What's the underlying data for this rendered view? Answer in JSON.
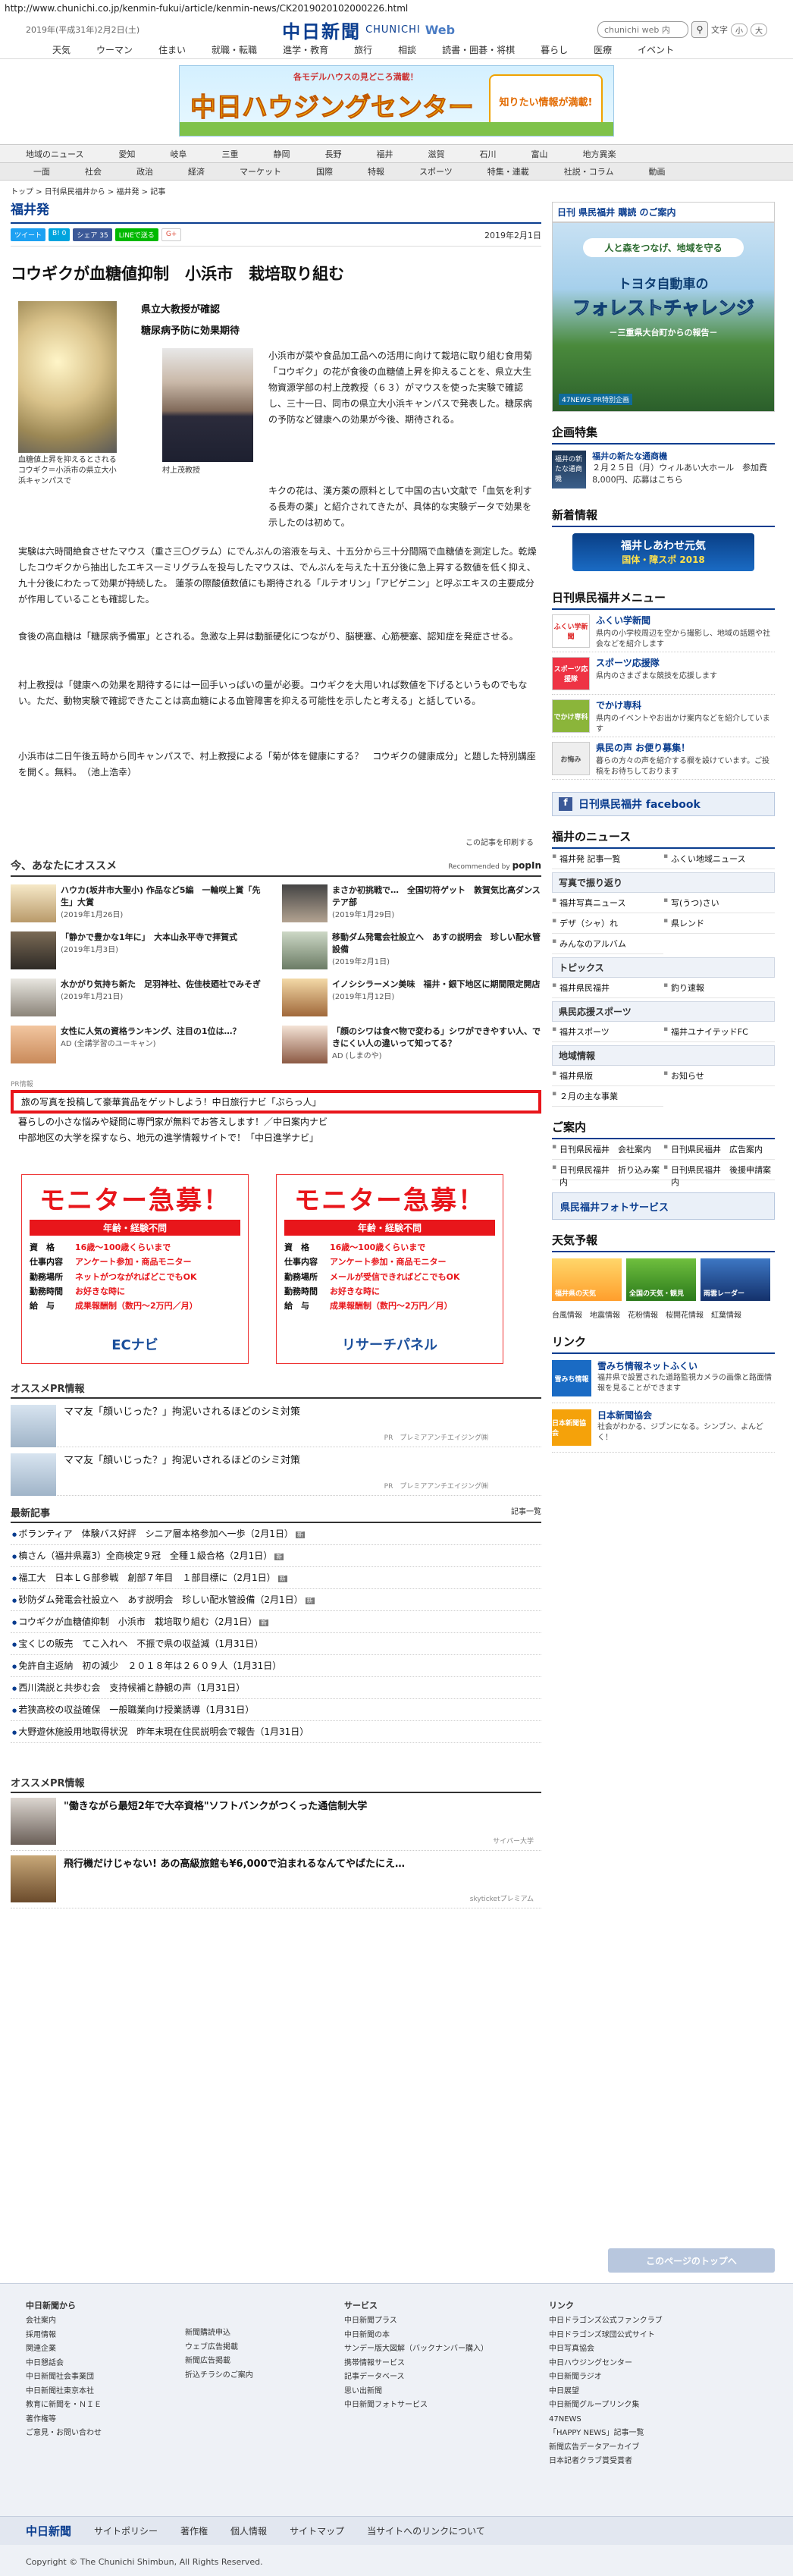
{
  "browser": {
    "url": "http://www.chunichi.co.jp/kenmin-fukui/article/kenmin-news/CK2019020102000226.html"
  },
  "header": {
    "date": "2019年(平成31年)2月2日(土)",
    "logo_jp": "中日新聞",
    "logo_en": "CHUNICHI",
    "logo_web": "Web",
    "search_placeholder": "chunichi web 内",
    "font_size_label": "文字",
    "font_small": "小",
    "font_large": "大"
  },
  "global_nav": [
    "天気",
    "ウーマン",
    "住まい",
    "就職・転職",
    "進学・教育",
    "旅行",
    "相談",
    "読書・囲碁・将棋",
    "暮らし",
    "医療",
    "イベント"
  ],
  "top_banner": {
    "sub": "各モデルハウスの見どころ満載！",
    "main": "中日ハウジングセンター",
    "right": "知りたい情報が満載!"
  },
  "region_nav": [
    "地域のニュース",
    "愛知",
    "岐阜",
    "三重",
    "静岡",
    "長野",
    "福井",
    "滋賀",
    "石川",
    "富山",
    "地方異楽"
  ],
  "category_nav": [
    "一面",
    "社会",
    "政治",
    "経済",
    "マーケット",
    "国際",
    "特報",
    "スポーツ",
    "特集・連載",
    "社説・コラム",
    "動画"
  ],
  "breadcrumb": "トップ > 日刊県民福井から > 福井発 > 記事",
  "section_title": "福井発",
  "share": {
    "tweet": "ツイート",
    "hatena": "B! 0",
    "fb_share": "シェア 35",
    "line": "LINEで送る",
    "gplus": "G+",
    "pub_date": "2019年2月1日"
  },
  "article": {
    "headline": "コウギクが血糖値抑制　小浜市　栽培取り組む",
    "photo_caption": "血糖値上昇を抑えるとされるコウギク＝小浜市の県立大小浜キャンパスで",
    "subhead1": "県立大教授が確認",
    "subhead2": "糖尿病予防に効果期待",
    "person_caption": "村上茂教授",
    "para1": "小浜市が菜や食品加工品への活用に向けて栽培に取り組む食用菊「コウギク」の花が食後の血糖値上昇を抑えることを、県立大生物資源学部の村上茂教授（６３）がマウスを使った実験で確認し、三十一日、同市の県立大小浜キャンパスで発表した。糖尿病の予防など健康への効果が今後、期待される。",
    "para2": "キクの花は、漢方薬の原料として中国の古い文献で「血気を利する長寿の薬」と紹介されてきたが、具体的な実験データで効果を示したのは初めて。",
    "para3": "実験は六時間絶食させたマウス（重さ三〇グラム）にでんぷんの溶液を与え、十五分から三十分間隔で血糖値を測定した。乾燥したコウギクから抽出したエキス一ミリグラムを投与したマウスは、でんぷんを与えた十五分後に急上昇する数値を低く抑え、九十分後にわたって効果が持続した。 蓮茶の際酸値数値にも期待される「ルテオリン」「アピゲニン」と呼ぶエキスの主要成分が作用していることも確認した。",
    "para4": "食後の高血糖は「糖尿病予備軍」とされる。急激な上昇は動脈硬化につながり、脳梗塞、心筋梗塞、認知症を発症させる。",
    "para5": "村上教授は「健康への効果を期待するには一回手いっぱいの量が必要。コウギクを大用いれば数値を下げるというものでもない。ただ、動物実験で確認できたことは高血糖による血管障害を抑える可能性を示したと考える」と話している。",
    "para6": "小浜市は二日午後五時から同キャンパスで、村上教授による「菊が体を健康にする？　コウギクの健康成分」と題した特別講座を開く。無料。　（池上浩幸）",
    "print": "この記事を印刷する"
  },
  "recommend": {
    "title": "今、あなたにオススメ",
    "recommended_by": "Recommended by",
    "popin": "popIn",
    "items": [
      {
        "title": "ハウカ(坂井市大聖小) 作品など5編　一輪咲上賞「先生」大賞",
        "date": "(2019年1月26日)"
      },
      {
        "title": "まさか初挑戦で…　全国切符ゲット　敦賀気比高ダンステア部",
        "date": "(2019年1月29日)"
      },
      {
        "title": "「静かで豊かな1年に」　大本山永平寺で拝賀式",
        "date": "(2019年1月3日)"
      },
      {
        "title": "移動ダム発電会社設立へ　あすの説明会　珍しい配水管設備",
        "date": "(2019年2月1日)"
      },
      {
        "title": "水かがり気持ち新た　足羽神社、佐佳枝廼社でみそぎ",
        "date": "(2019年1月21日)"
      },
      {
        "title": "イノシシラーメン美味　福井・銀下地区に期間限定開店",
        "date": "(2019年1月12日)"
      },
      {
        "title": "女性に人気の資格ランキング、注目の1位は…？",
        "date": "AD (全講学習のユーキャン)"
      },
      {
        "title": "「顔のシワは食べ物で変わる」シワができやすい人、できにくい人の違いって知ってる？",
        "date": "AD (しまのや)"
      }
    ]
  },
  "pr_info": {
    "label": "PR情報",
    "items": [
      "旅の写真を投稿して豪華賞品をゲットしよう！中日旅行ナビ「ぶらっ人」",
      "暮らしの小さな悩みや疑問に専門家が無料でお答えします！／中日案内ナビ",
      "中部地区の大学を探すなら、地元の進学情報サイトで！「中日進学ナビ」"
    ]
  },
  "monitor_ads": [
    {
      "title": "モニター急募！",
      "band": "年齢・経験不問",
      "rows": [
        [
          "資　格",
          "16歳〜100歳くらいまで"
        ],
        [
          "仕事内容",
          "アンケート参加・商品モニター"
        ],
        [
          "勤務場所",
          "ネットがつながればどこでもOK"
        ],
        [
          "勤務時間",
          "お好きな時に"
        ],
        [
          "給　与",
          "成果報酬制（数円〜2万円／月）"
        ]
      ],
      "logo": "ECナビ"
    },
    {
      "title": "モニター急募！",
      "band": "年齢・経験不問",
      "rows": [
        [
          "資　格",
          "16歳〜100歳くらいまで"
        ],
        [
          "仕事内容",
          "アンケート参加・商品モニター"
        ],
        [
          "勤務場所",
          "メールが受信できればどこでもOK"
        ],
        [
          "勤務時間",
          "お好きな時に"
        ],
        [
          "給　与",
          "成果報酬制（数円〜2万円／月）"
        ]
      ],
      "logo": "リサーチパネル"
    }
  ],
  "osusume_pr": {
    "title": "オススメPR情報",
    "items": [
      {
        "title": "ママ友「顔いじった？」拘泥いされるほどのシミ対策",
        "sponsor": "PR　プレミアアンチエイジング㈱"
      },
      {
        "title": "ママ友「顔いじった？」拘泥いされるほどのシミ対策",
        "sponsor": "PR　プレミアアンチエイジング㈱"
      }
    ]
  },
  "latest": {
    "title": "最新記事",
    "more": "記事一覧",
    "items": [
      "ボランティア　体験バス好評　シニア層本格参加へ一歩（2月1日）",
      "槙さん（福井県嘉3）全商検定９冠　全種１級合格（2月1日）",
      "福工大　日本ＬＧ部参戦　創部７年目　１部目標に（2月1日）",
      "砂防ダム発電会社設立へ　あす説明会　珍しい配水管設備（2月1日）",
      "コウギクが血糖値抑制　小浜市　栽培取り組む（2月1日）",
      "宝くじの販売　てこ入れへ　不振で県の収益減（1月31日）",
      "免許自主返納　初の減少　２０１８年は２６０９人（1月31日）",
      "西川満説と共歩む会　支持候補と静観の声（1月31日）",
      "若狭高校の収益確保　一般職業向け授業誘導（1月31日）",
      "大野遊休施設用地取得状況　昨年末現在住民説明会で報告（1月31日）"
    ]
  },
  "osusume_pr2": {
    "title": "オススメPR情報",
    "items": [
      {
        "title": "\"働きながら最短2年で大卒資格\"ソフトバンクがつくった通信制大学",
        "sponsor": "サイバー大学"
      },
      {
        "title": "飛行機だけじゃない! あの高級旅館も¥6,000で泊まれるなんてやばたにえ…",
        "sponsor": "skyticketプレミアム"
      }
    ]
  },
  "sidebar": {
    "kenmin_head": "日刊 県民福井 購読 のご案内",
    "forest": {
      "f1": "人と森をつなげ、地域を守る",
      "f2": "トヨタ自動車の",
      "f3": "フォレストチャレンジ",
      "f4": "－三重県大台町からの報告－",
      "f5": "47NEWS PR特別企画"
    },
    "kikaku_title": "企画特集",
    "kikaku": {
      "thumb": "福井の新たな通商機",
      "title": "福井の新たな通商機",
      "text": "２月２５日（月）ウィルあい大ホール　参加費8,000円、応募はこちら"
    },
    "sinchaku_title": "新着情報",
    "sinchaku": {
      "main": "福井しあわせ元気",
      "sub": "国体・障スポ 2018"
    },
    "menu_title": "日刊県民福井メニュー",
    "menu": [
      {
        "icon": "ふくい学新聞",
        "title": "ふくい学新聞",
        "text": "県内の小学校周辺を空から撮影し、地域の話題や社会などを紹介します"
      },
      {
        "icon": "スポーツ応援隊",
        "title": "スポーツ応援隊",
        "text": "県内のさまざまな競技を応援します"
      },
      {
        "icon": "でかけ専科",
        "title": "でかけ専科",
        "text": "県内のイベントやお出かけ案内などを紹介しています"
      },
      {
        "icon": "お悔み",
        "title": "県民の声 お便り募集！",
        "text": "暮らの方々の声を紹介する欄を設けています。ご投稿をお待ちしております"
      }
    ],
    "fb": "日刊県民福井 facebook",
    "news_title": "福井のニュース",
    "news_grid": [
      "福井発 記事一覧",
      "ふくい地域ニュース",
      "写真で見るニュース",
      "福井発ニュース",
      "写(うつ)さい",
      "デザ（シャ）れ",
      "県レンド",
      "みんなのアルバム"
    ],
    "groups": [
      {
        "name": "写真で振り返り",
        "items": [
          "福井写真ニュース",
          "写(うつ)さい"
        ]
      },
      {
        "name": "トピックス",
        "items": [
          "福井県民福井",
          "釣り速報"
        ]
      },
      {
        "name": "県民応援スポーツ",
        "items": [
          "福井スポーツ",
          "福井ユナイテッドFC"
        ]
      },
      {
        "name": "地域情報",
        "items": [
          "福井県版",
          "お知らせ"
        ]
      }
    ],
    "feature": "２月の主な事業",
    "annai_title": "ご案内",
    "annai": [
      "日刊県民福井　会社案内",
      "日刊県民福井　広告案内",
      "日刊県民福井　折り込み案内",
      "日刊県民福井　後援申請案内"
    ],
    "photo_service": "県民福井フォトサービス",
    "weather_title": "天気予報",
    "weather": [
      "福井県の天気",
      "全国の天気・観見",
      "雨雲レーダー"
    ],
    "weather_links": [
      "台風情報",
      "地震情報",
      "花粉情報",
      "桜開花情報",
      "紅葉情報"
    ],
    "link_title": "リンク",
    "links": [
      {
        "icon": "雪みち情報",
        "title": "雪みち情報ネットふくい",
        "text": "福井県で設置された道路監視カメラの画像と路面情報を見ることができます"
      },
      {
        "icon": "日本新聞協会",
        "title": "日本新聞協会",
        "text": "社会がわかる、ジブンになる。シンブン、よんどく！"
      }
    ]
  },
  "pagetop": "このページのトップへ",
  "footer": {
    "cols": [
      {
        "head": "中日新聞から",
        "items": [
          "会社案内",
          "採用情報",
          "関連企業",
          "中日懇話会",
          "中日新聞社会事業団",
          "中日新聞社東京本社",
          "教育に新聞を・ＮＩＥ",
          "著作権等",
          "ご意見・お問い合わせ"
        ]
      },
      {
        "head": "",
        "items": [
          "新聞購読申込",
          "ウェブ広告掲載",
          "新聞広告掲載",
          "折込チラシのご案内"
        ]
      },
      {
        "head": "サービス",
        "items": [
          "中日新聞プラス",
          "中日新聞の本",
          "サンデー版大図解（バックナンバー購入）",
          "携帯情報サービス",
          "記事データベース",
          "思い出新聞",
          "中日新聞フォトサービス"
        ]
      },
      {
        "head": "リンク",
        "items": [
          "中日ドラゴンズ公式ファンクラブ",
          "中日ドラゴンズ球団公式サイト",
          "中日写真協会",
          "中日ハウジングセンター",
          "中日新聞ラジオ",
          "中日展望",
          "中日新聞グループリンク集",
          "47NEWS",
          "「HAPPY NEWS」記事一覧",
          "新聞広告データアーカイブ",
          "日本記者クラブ賞受賞者"
        ]
      }
    ],
    "bar": {
      "logo": "中日新聞",
      "links": [
        "サイトポリシー",
        "著作権",
        "個人情報",
        "サイトマップ",
        "当サイトへのリンクについて"
      ]
    },
    "copyright": "Copyright © The Chunichi Shimbun, All Rights Reserved."
  }
}
